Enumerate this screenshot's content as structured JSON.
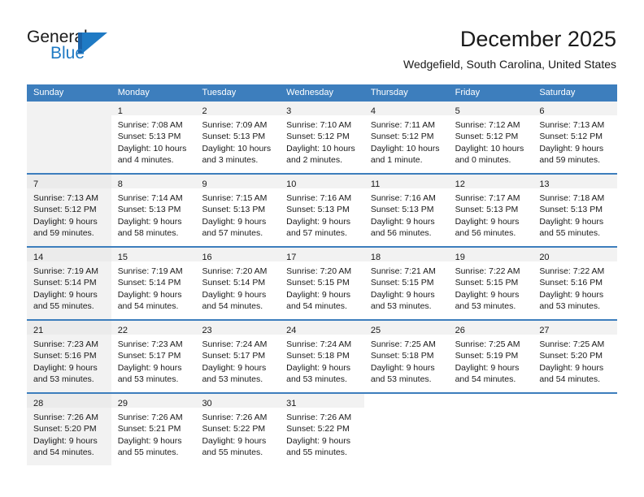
{
  "brand": {
    "name_part1": "General",
    "name_part2": "Blue",
    "accent_color": "#1f7ac4",
    "mark_icon": "triangle-flag-icon"
  },
  "header": {
    "title": "December 2025",
    "subtitle": "Wedgefield, South Carolina, United States"
  },
  "calendar": {
    "header_bg": "#3d7ebd",
    "weekdays": [
      "Sunday",
      "Monday",
      "Tuesday",
      "Wednesday",
      "Thursday",
      "Friday",
      "Saturday"
    ],
    "weeks": [
      [
        {
          "day": "",
          "sunrise": "",
          "sunset": "",
          "daylight_1": "",
          "daylight_2": ""
        },
        {
          "day": "1",
          "sunrise": "Sunrise: 7:08 AM",
          "sunset": "Sunset: 5:13 PM",
          "daylight_1": "Daylight: 10 hours",
          "daylight_2": "and 4 minutes."
        },
        {
          "day": "2",
          "sunrise": "Sunrise: 7:09 AM",
          "sunset": "Sunset: 5:13 PM",
          "daylight_1": "Daylight: 10 hours",
          "daylight_2": "and 3 minutes."
        },
        {
          "day": "3",
          "sunrise": "Sunrise: 7:10 AM",
          "sunset": "Sunset: 5:12 PM",
          "daylight_1": "Daylight: 10 hours",
          "daylight_2": "and 2 minutes."
        },
        {
          "day": "4",
          "sunrise": "Sunrise: 7:11 AM",
          "sunset": "Sunset: 5:12 PM",
          "daylight_1": "Daylight: 10 hours",
          "daylight_2": "and 1 minute."
        },
        {
          "day": "5",
          "sunrise": "Sunrise: 7:12 AM",
          "sunset": "Sunset: 5:12 PM",
          "daylight_1": "Daylight: 10 hours",
          "daylight_2": "and 0 minutes."
        },
        {
          "day": "6",
          "sunrise": "Sunrise: 7:13 AM",
          "sunset": "Sunset: 5:12 PM",
          "daylight_1": "Daylight: 9 hours",
          "daylight_2": "and 59 minutes."
        }
      ],
      [
        {
          "day": "7",
          "sunrise": "Sunrise: 7:13 AM",
          "sunset": "Sunset: 5:12 PM",
          "daylight_1": "Daylight: 9 hours",
          "daylight_2": "and 59 minutes."
        },
        {
          "day": "8",
          "sunrise": "Sunrise: 7:14 AM",
          "sunset": "Sunset: 5:13 PM",
          "daylight_1": "Daylight: 9 hours",
          "daylight_2": "and 58 minutes."
        },
        {
          "day": "9",
          "sunrise": "Sunrise: 7:15 AM",
          "sunset": "Sunset: 5:13 PM",
          "daylight_1": "Daylight: 9 hours",
          "daylight_2": "and 57 minutes."
        },
        {
          "day": "10",
          "sunrise": "Sunrise: 7:16 AM",
          "sunset": "Sunset: 5:13 PM",
          "daylight_1": "Daylight: 9 hours",
          "daylight_2": "and 57 minutes."
        },
        {
          "day": "11",
          "sunrise": "Sunrise: 7:16 AM",
          "sunset": "Sunset: 5:13 PM",
          "daylight_1": "Daylight: 9 hours",
          "daylight_2": "and 56 minutes."
        },
        {
          "day": "12",
          "sunrise": "Sunrise: 7:17 AM",
          "sunset": "Sunset: 5:13 PM",
          "daylight_1": "Daylight: 9 hours",
          "daylight_2": "and 56 minutes."
        },
        {
          "day": "13",
          "sunrise": "Sunrise: 7:18 AM",
          "sunset": "Sunset: 5:13 PM",
          "daylight_1": "Daylight: 9 hours",
          "daylight_2": "and 55 minutes."
        }
      ],
      [
        {
          "day": "14",
          "sunrise": "Sunrise: 7:19 AM",
          "sunset": "Sunset: 5:14 PM",
          "daylight_1": "Daylight: 9 hours",
          "daylight_2": "and 55 minutes."
        },
        {
          "day": "15",
          "sunrise": "Sunrise: 7:19 AM",
          "sunset": "Sunset: 5:14 PM",
          "daylight_1": "Daylight: 9 hours",
          "daylight_2": "and 54 minutes."
        },
        {
          "day": "16",
          "sunrise": "Sunrise: 7:20 AM",
          "sunset": "Sunset: 5:14 PM",
          "daylight_1": "Daylight: 9 hours",
          "daylight_2": "and 54 minutes."
        },
        {
          "day": "17",
          "sunrise": "Sunrise: 7:20 AM",
          "sunset": "Sunset: 5:15 PM",
          "daylight_1": "Daylight: 9 hours",
          "daylight_2": "and 54 minutes."
        },
        {
          "day": "18",
          "sunrise": "Sunrise: 7:21 AM",
          "sunset": "Sunset: 5:15 PM",
          "daylight_1": "Daylight: 9 hours",
          "daylight_2": "and 53 minutes."
        },
        {
          "day": "19",
          "sunrise": "Sunrise: 7:22 AM",
          "sunset": "Sunset: 5:15 PM",
          "daylight_1": "Daylight: 9 hours",
          "daylight_2": "and 53 minutes."
        },
        {
          "day": "20",
          "sunrise": "Sunrise: 7:22 AM",
          "sunset": "Sunset: 5:16 PM",
          "daylight_1": "Daylight: 9 hours",
          "daylight_2": "and 53 minutes."
        }
      ],
      [
        {
          "day": "21",
          "sunrise": "Sunrise: 7:23 AM",
          "sunset": "Sunset: 5:16 PM",
          "daylight_1": "Daylight: 9 hours",
          "daylight_2": "and 53 minutes."
        },
        {
          "day": "22",
          "sunrise": "Sunrise: 7:23 AM",
          "sunset": "Sunset: 5:17 PM",
          "daylight_1": "Daylight: 9 hours",
          "daylight_2": "and 53 minutes."
        },
        {
          "day": "23",
          "sunrise": "Sunrise: 7:24 AM",
          "sunset": "Sunset: 5:17 PM",
          "daylight_1": "Daylight: 9 hours",
          "daylight_2": "and 53 minutes."
        },
        {
          "day": "24",
          "sunrise": "Sunrise: 7:24 AM",
          "sunset": "Sunset: 5:18 PM",
          "daylight_1": "Daylight: 9 hours",
          "daylight_2": "and 53 minutes."
        },
        {
          "day": "25",
          "sunrise": "Sunrise: 7:25 AM",
          "sunset": "Sunset: 5:18 PM",
          "daylight_1": "Daylight: 9 hours",
          "daylight_2": "and 53 minutes."
        },
        {
          "day": "26",
          "sunrise": "Sunrise: 7:25 AM",
          "sunset": "Sunset: 5:19 PM",
          "daylight_1": "Daylight: 9 hours",
          "daylight_2": "and 54 minutes."
        },
        {
          "day": "27",
          "sunrise": "Sunrise: 7:25 AM",
          "sunset": "Sunset: 5:20 PM",
          "daylight_1": "Daylight: 9 hours",
          "daylight_2": "and 54 minutes."
        }
      ],
      [
        {
          "day": "28",
          "sunrise": "Sunrise: 7:26 AM",
          "sunset": "Sunset: 5:20 PM",
          "daylight_1": "Daylight: 9 hours",
          "daylight_2": "and 54 minutes."
        },
        {
          "day": "29",
          "sunrise": "Sunrise: 7:26 AM",
          "sunset": "Sunset: 5:21 PM",
          "daylight_1": "Daylight: 9 hours",
          "daylight_2": "and 55 minutes."
        },
        {
          "day": "30",
          "sunrise": "Sunrise: 7:26 AM",
          "sunset": "Sunset: 5:22 PM",
          "daylight_1": "Daylight: 9 hours",
          "daylight_2": "and 55 minutes."
        },
        {
          "day": "31",
          "sunrise": "Sunrise: 7:26 AM",
          "sunset": "Sunset: 5:22 PM",
          "daylight_1": "Daylight: 9 hours",
          "daylight_2": "and 55 minutes."
        },
        {
          "day": "",
          "sunrise": "",
          "sunset": "",
          "daylight_1": "",
          "daylight_2": ""
        },
        {
          "day": "",
          "sunrise": "",
          "sunset": "",
          "daylight_1": "",
          "daylight_2": ""
        },
        {
          "day": "",
          "sunrise": "",
          "sunset": "",
          "daylight_1": "",
          "daylight_2": ""
        }
      ]
    ]
  }
}
